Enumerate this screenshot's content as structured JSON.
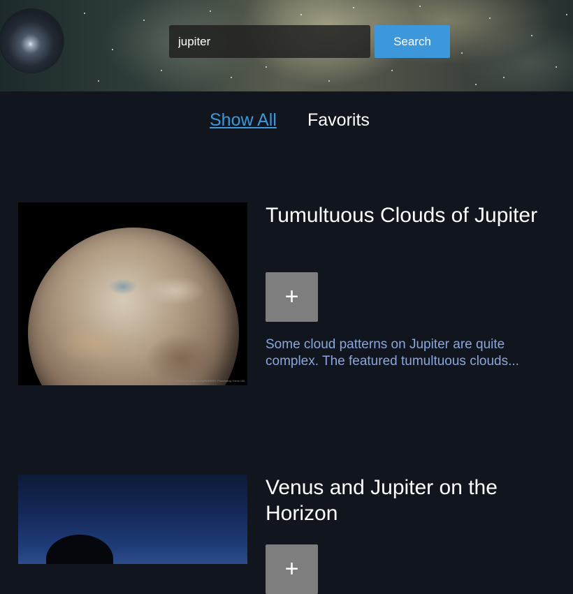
{
  "header": {
    "logo_icon": "galaxy-logo-icon",
    "search": {
      "value": "jupiter",
      "placeholder": "",
      "button_label": "Search"
    }
  },
  "tabs": [
    {
      "label": "Show All",
      "active": true
    },
    {
      "label": "Favorits",
      "active": false
    }
  ],
  "colors": {
    "accent": "#3d98db",
    "background": "#11151e",
    "description": "#8aa6dc",
    "favorite_button": "#7e7e7e"
  },
  "results": [
    {
      "title": "Tumultuous Clouds of Jupiter",
      "favorite_label": "+",
      "description": "Some cloud patterns on Jupiter are quite complex. The featured tumultuous clouds...",
      "image_credit": "NASA/JPL-Caltech/SwRI/MSSS; Processing: Kevin Gill"
    },
    {
      "title": "Venus and Jupiter on the Horizon",
      "favorite_label": "+"
    }
  ]
}
